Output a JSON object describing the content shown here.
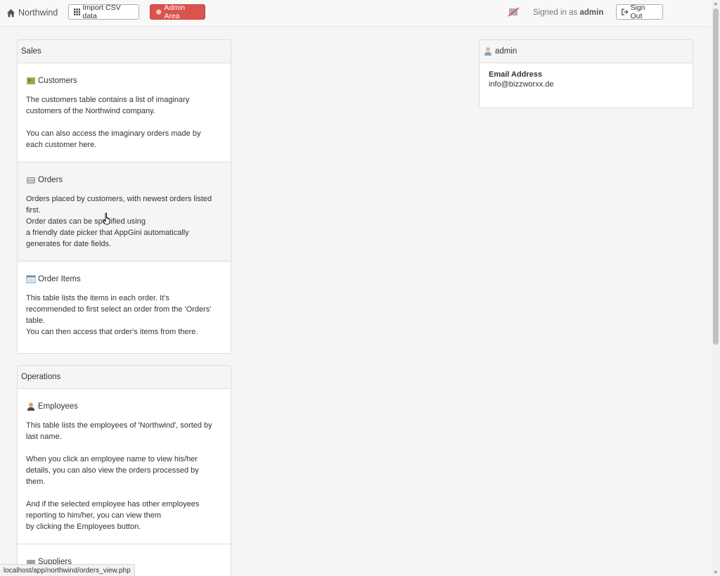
{
  "navbar": {
    "brand": "Northwind",
    "import_label": "Import CSV data",
    "admin_label": "Admin Area",
    "signed_in_prefix": "Signed in as",
    "username": "admin",
    "signout_label": "Sign Out"
  },
  "sales": {
    "heading": "Sales",
    "items": [
      {
        "title": "Customers",
        "icon": "customers-icon",
        "desc": "The customers table contains a list of imaginary\ncustomers of the Northwind company.\n\nYou can also access the imaginary orders made by\neach customer here."
      },
      {
        "title": "Orders",
        "icon": "orders-icon",
        "desc": "Orders placed by customers, with newest orders listed\nfirst.\nOrder dates can be specified using\na friendly date picker that AppGini automatically\ngenerates for date fields."
      },
      {
        "title": "Order Items",
        "icon": "order-items-icon",
        "desc": "This table lists the items in each order. It's\nrecommended to first select an order from the 'Orders'\ntable.\nYou can then access that order's items from there."
      }
    ]
  },
  "operations": {
    "heading": "Operations",
    "items": [
      {
        "title": "Employees",
        "icon": "employee-icon",
        "desc": "This table lists the employees of 'Northwind', sorted by\nlast name.\n\nWhen you click an employee name to view his/her\ndetails, you can also view the orders processed by\nthem.\n\nAnd if the selected employee has other employees\nreporting to him/her, you can view them\nby clicking the Employees button."
      },
      {
        "title": "Suppliers",
        "icon": "suppliers-icon",
        "desc": ""
      }
    ]
  },
  "user_panel": {
    "name": "admin",
    "email_label": "Email Address",
    "email": "info@bizzworxx.de"
  },
  "status_bar": {
    "url": "localhost/app/northwind/orders_view.php"
  },
  "colors": {
    "danger": "#d9534f",
    "panel_heading": "#f5f5f5",
    "hover_row": "#f5f5f5"
  }
}
